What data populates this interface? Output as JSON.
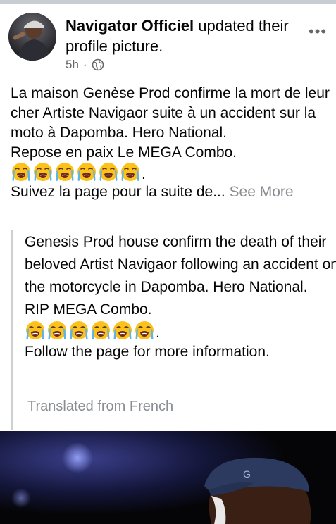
{
  "post": {
    "author": "Navigator Officiel",
    "action": " updated their profile picture.",
    "time": "5h",
    "privacy_icon": "globe-icon",
    "menu_icon": "more-options-icon"
  },
  "body": {
    "paragraph": "La maison Genèse Prod confirme la mort de leur cher Artiste Navigaor suite à un accident sur la moto à Dapomba. Hero National.",
    "rip_line": "Repose en paix Le MEGA Combo.",
    "emoji_name": "loudly-crying-face",
    "emoji_count": 6,
    "emoji_suffix": ".",
    "truncated_line": "Suivez la page pour la suite de...",
    "see_more": "See More"
  },
  "translation": {
    "paragraph": "Genesis Prod house confirm the death of their beloved Artist Navigaor following an accident on the motorcycle in Dapomba. Hero National.",
    "rip_line": "RIP MEGA Combo.",
    "emoji_suffix": ".",
    "follow_line": "Follow the page for more information.",
    "note": "Translated from French"
  },
  "colors": {
    "muted": "#65676b",
    "quote_bar": "#ced0d4",
    "see_more": "#8a8d91"
  }
}
